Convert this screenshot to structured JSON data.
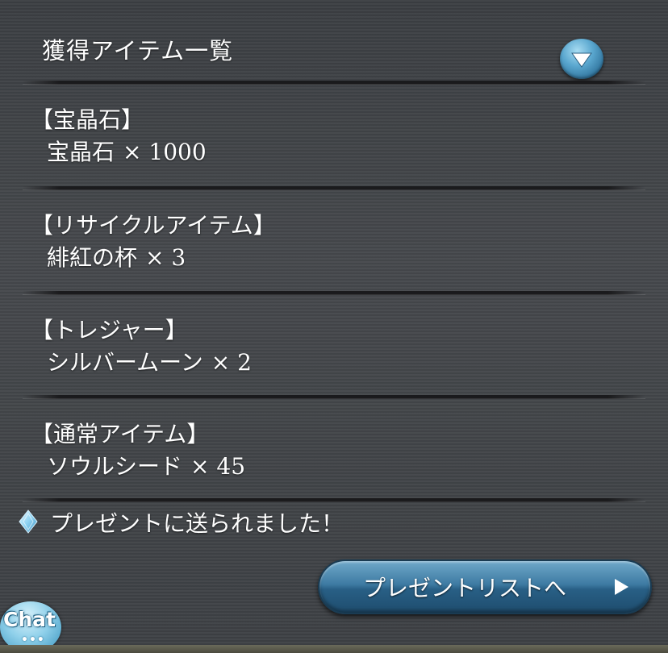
{
  "header": {
    "title": "獲得アイテム一覧"
  },
  "sections": [
    {
      "heading": "【宝晶石】",
      "item_name": "宝晶石",
      "item_qty": "× 1000"
    },
    {
      "heading": "【リサイクルアイテム】",
      "item_name": "緋紅の杯",
      "item_qty": "× 3"
    },
    {
      "heading": "【トレジャー】",
      "item_name": "シルバームーン",
      "item_qty": "× 2"
    },
    {
      "heading": "【通常アイテム】",
      "item_name": "ソウルシード",
      "item_qty": "× 45"
    }
  ],
  "notice": {
    "text": "プレゼントに送られました！",
    "icon": "crystal-icon"
  },
  "present_button": {
    "label": "プレゼントリストへ",
    "icon": "arrow-right-icon"
  },
  "chat": {
    "label": "Chat",
    "dots": "•••"
  },
  "colors": {
    "accent_blue": "#3e7ba3",
    "background": "#3e4145"
  }
}
